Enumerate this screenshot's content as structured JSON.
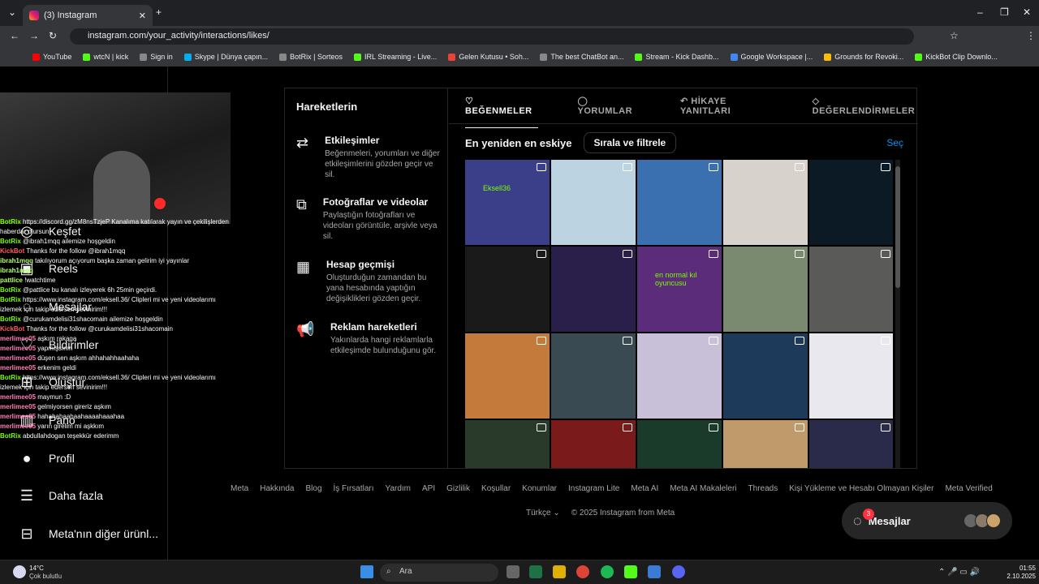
{
  "browser": {
    "tab_title": "(3) Instagram",
    "url": "instagram.com/your_activity/interactions/likes/",
    "bookmarks": [
      "YouTube",
      "wtcN | kick",
      "Sign in",
      "Skype | Dünya çapın...",
      "BotRix | Sorteos",
      "IRL Streaming - Live...",
      "Gelen Kutusu • Soh...",
      "The best ChatBot an...",
      "Stream - Kick Dashb...",
      "Google Workspace |...",
      "Grounds for Revoki...",
      "KickBot Clip Downlo..."
    ]
  },
  "sidebar": {
    "items": [
      {
        "label": "Keşfet",
        "icon": "compass-icon"
      },
      {
        "label": "Reels",
        "icon": "reels-icon"
      },
      {
        "label": "Mesajlar",
        "icon": "messenger-icon"
      },
      {
        "label": "Bildirimler",
        "icon": "heart-icon"
      },
      {
        "label": "Oluştur",
        "icon": "plus-icon"
      },
      {
        "label": "Pano",
        "icon": "dashboard-icon"
      },
      {
        "label": "Profil",
        "icon": "avatar-icon"
      },
      {
        "label": "Daha fazla",
        "icon": "menu-icon"
      },
      {
        "label": "Meta'nın diğer ürünl...",
        "icon": "meta-apps-icon"
      }
    ]
  },
  "chat": [
    {
      "user": "BotRix",
      "text": "https://discord.gg/zM8nsTzjeP Kanalıma katılarak yayın ve çekilişlerden haberdar olursun!"
    },
    {
      "user": "BotRix",
      "text": "@ibrah1mqq ailemize hoşgeldin"
    },
    {
      "user": "KickBot",
      "text": "Thanks for the follow @ibrah1mqq"
    },
    {
      "user": "ibrah1mqq",
      "text": "takılıyorum açıyorum başka zaman gelirim iyi yayınlar"
    },
    {
      "user": "ibrah1mqq",
      "text": ""
    },
    {
      "user": "pattlice",
      "text": "!watchtime"
    },
    {
      "user": "BotRix",
      "text": "@pattlice bu kanalı izleyerek 6h 25min geçirdi."
    },
    {
      "user": "BotRix",
      "text": "https://www.instagram.com/eksell.36/ Clipleri mi ve yeni videolarımı izlemek için takip edersen sevinirim!!!"
    },
    {
      "user": "BotRix",
      "text": "@curukamdelisi31shacomain ailemize hoşgeldin"
    },
    {
      "user": "KickBot",
      "text": "Thanks for the follow @curukamdelisi31shacomain"
    },
    {
      "user": "merlimee05",
      "text": "aşkım rakaga"
    },
    {
      "user": "merlimee05",
      "text": "yapmışsının"
    },
    {
      "user": "merlimee05",
      "text": "düşen sen aşkım ahhahahhaahaha"
    },
    {
      "user": "merlimee05",
      "text": "erkenim geldi"
    },
    {
      "user": "BotRix",
      "text": "https://www.instagram.com/eksell.36/ Clipleri mi ve yeni videolarımı izlemek için takip edersen sevinirim!!!"
    },
    {
      "user": "merlimee05",
      "text": "maymun :D"
    },
    {
      "user": "merlimee05",
      "text": "gelmiyorsen gireriz aşkım"
    },
    {
      "user": "merlimee05",
      "text": "hahahahaahaahaaaahaaahaa"
    },
    {
      "user": "merlimee05",
      "text": "yarın girelim mi aşkkım"
    },
    {
      "user": "BotRix",
      "text": "abdullahdogan teşekkür ederimm"
    }
  ],
  "panel": {
    "title": "Hareketlerin",
    "sections": [
      {
        "title": "Etkileşimler",
        "desc": "Beğenmeleri, yorumları ve diğer etkileşimlerini gözden geçir ve sil.",
        "icon": "arrows-icon"
      },
      {
        "title": "Fotoğraflar ve videolar",
        "desc": "Paylaştığın fotoğrafları ve videoları görüntüle, arşivle veya sil.",
        "icon": "photos-icon"
      },
      {
        "title": "Hesap geçmişi",
        "desc": "Oluşturduğun zamandan bu yana hesabında yaptığın değişiklikleri gözden geçir.",
        "icon": "calendar-icon"
      },
      {
        "title": "Reklam hareketleri",
        "desc": "Yakınlarda hangi reklamlarla etkileşimde bulunduğunu gör.",
        "icon": "megaphone-icon"
      }
    ],
    "tabs": [
      "BEĞENMELER",
      "YORUMLAR",
      "HİKAYE YANITLARI",
      "DEĞERLENDİRMELER"
    ],
    "sort_label": "En yeniden en eskiye",
    "sort_button": "Sırala ve filtrele",
    "select": "Seç",
    "tiles": [
      "#3b3f8a",
      "#bcd3e2",
      "#3a6fb0",
      "#d8d2cc",
      "#0b1a24",
      "#1a1a1a",
      "#2a1e4a",
      "#5a2c7a",
      "#7a8a70",
      "#5a5a58",
      "#c47a3a",
      "#3a4a52",
      "#c8c0d8",
      "#1e3a5a",
      "#e8e8ee",
      "#2a3a2a",
      "#7a1a1a",
      "#1a3a2a",
      "#c09a6a",
      "#2a2a4a"
    ],
    "tile_label": "Eksell36",
    "tile_label2": "en normal kıl oyuncusu"
  },
  "footer": {
    "links": [
      "Meta",
      "Hakkında",
      "Blog",
      "İş Fırsatları",
      "Yardım",
      "API",
      "Gizlilik",
      "Koşullar",
      "Konumlar",
      "Instagram Lite",
      "Meta AI",
      "Meta AI Makaleleri",
      "Threads",
      "Kişi Yükleme ve Hesabı Olmayan Kişiler",
      "Meta Verified"
    ],
    "language": "Türkçe",
    "copyright": "© 2025 Instagram from Meta"
  },
  "messages": {
    "label": "Mesajlar",
    "badge": "3"
  },
  "taskbar": {
    "weather_temp": "14°C",
    "weather_desc": "Çok bulutlu",
    "search": "Ara",
    "time": "01:55",
    "date": "2.10.2025"
  }
}
